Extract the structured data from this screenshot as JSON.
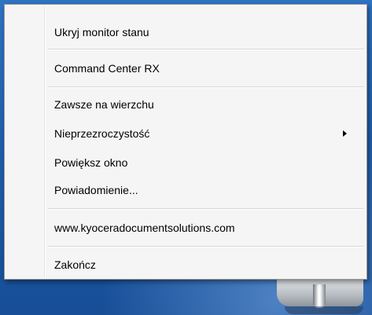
{
  "context_menu": {
    "items": [
      {
        "label": "Ukryj monitor stanu"
      },
      {
        "label": "Command Center RX"
      },
      {
        "label": "Zawsze na wierzchu"
      },
      {
        "label": "Nieprzezroczystość",
        "has_submenu": true,
        "arrow_icon": "submenu-arrow-icon"
      },
      {
        "label": "Powiększ okno"
      },
      {
        "label": "Powiadomienie..."
      },
      {
        "label": "www.kyoceradocumentsolutions.com"
      },
      {
        "label": "Zakończ"
      }
    ]
  },
  "colors": {
    "desktop_background": "#1f5fae",
    "menu_background": "#f5f5f5",
    "menu_border": "#979797",
    "separator": "#d7d7d7"
  }
}
